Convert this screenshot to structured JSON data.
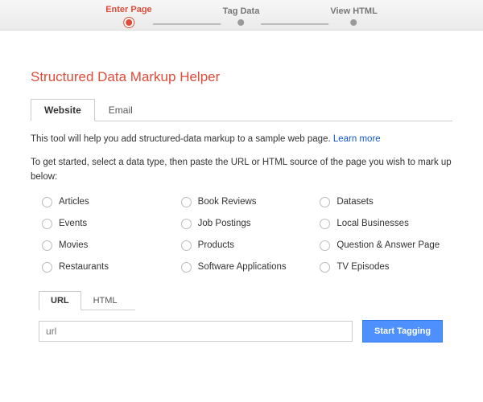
{
  "steps": [
    {
      "label": "Enter Page",
      "active": true
    },
    {
      "label": "Tag Data",
      "active": false
    },
    {
      "label": "View HTML",
      "active": false
    }
  ],
  "title": "Structured Data Markup Helper",
  "tabs": [
    {
      "label": "Website",
      "active": true
    },
    {
      "label": "Email",
      "active": false
    }
  ],
  "intro_text": "This tool will help you add structured-data markup to a sample web page. ",
  "learn_more": "Learn more",
  "description": "To get started, select a data type, then paste the URL or HTML source of the page you wish to mark up below:",
  "data_types": [
    "Articles",
    "Book Reviews",
    "Datasets",
    "Events",
    "Job Postings",
    "Local Businesses",
    "Movies",
    "Products",
    "Question & Answer Page",
    "Restaurants",
    "Software Applications",
    "TV Episodes"
  ],
  "subtabs": [
    {
      "label": "URL",
      "active": true
    },
    {
      "label": "HTML",
      "active": false
    }
  ],
  "url_placeholder": "url",
  "start_button": "Start Tagging"
}
